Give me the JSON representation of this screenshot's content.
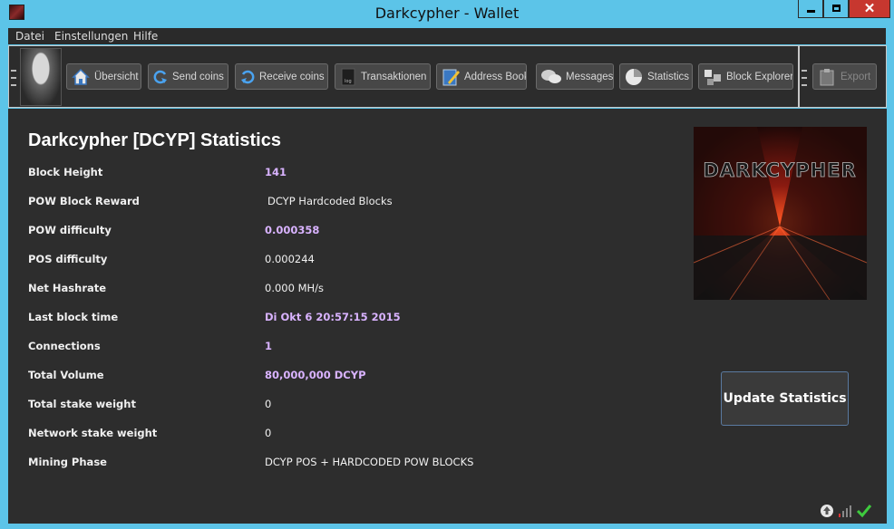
{
  "window": {
    "title": "Darkcypher - Wallet"
  },
  "menu": {
    "items": [
      "Datei",
      "Einstellungen",
      "Hilfe"
    ]
  },
  "toolbar": {
    "buttons": [
      "Übersicht",
      "Send coins",
      "Receive coins",
      "Transaktionen",
      "Address Book",
      "Messages",
      "Statistics",
      "Block Explorer"
    ],
    "export": "Export"
  },
  "stats": {
    "title": "Darkcypher [DCYP] Statistics",
    "rows": [
      {
        "label": "Block Height",
        "value": "141"
      },
      {
        "label": "POW Block Reward",
        "value": "DCYP Hardcoded Blocks"
      },
      {
        "label": "POW difficulty",
        "value": "0.000358"
      },
      {
        "label": "POS difficulty",
        "value": "0.000244"
      },
      {
        "label": "Net Hashrate",
        "value": "0.000 MH/s"
      },
      {
        "label": "Last block time",
        "value": "Di Okt 6 20:57:15 2015"
      },
      {
        "label": "Connections",
        "value": "1"
      },
      {
        "label": "Total Volume",
        "value": "80,000,000 DCYP"
      },
      {
        "label": "Total stake weight",
        "value": "0"
      },
      {
        "label": "Network stake weight",
        "value": "0"
      },
      {
        "label": "Mining Phase",
        "value": "DCYP POS + HARDCODED POW BLOCKS"
      }
    ],
    "update_button": "Update Statistics"
  },
  "logo_text": "DARKCYPHER",
  "colors": {
    "titlebar": "#5cc4e8",
    "background": "#2d2d2d",
    "highlight_value": "#d9b3ff",
    "close": "#c7372f"
  }
}
